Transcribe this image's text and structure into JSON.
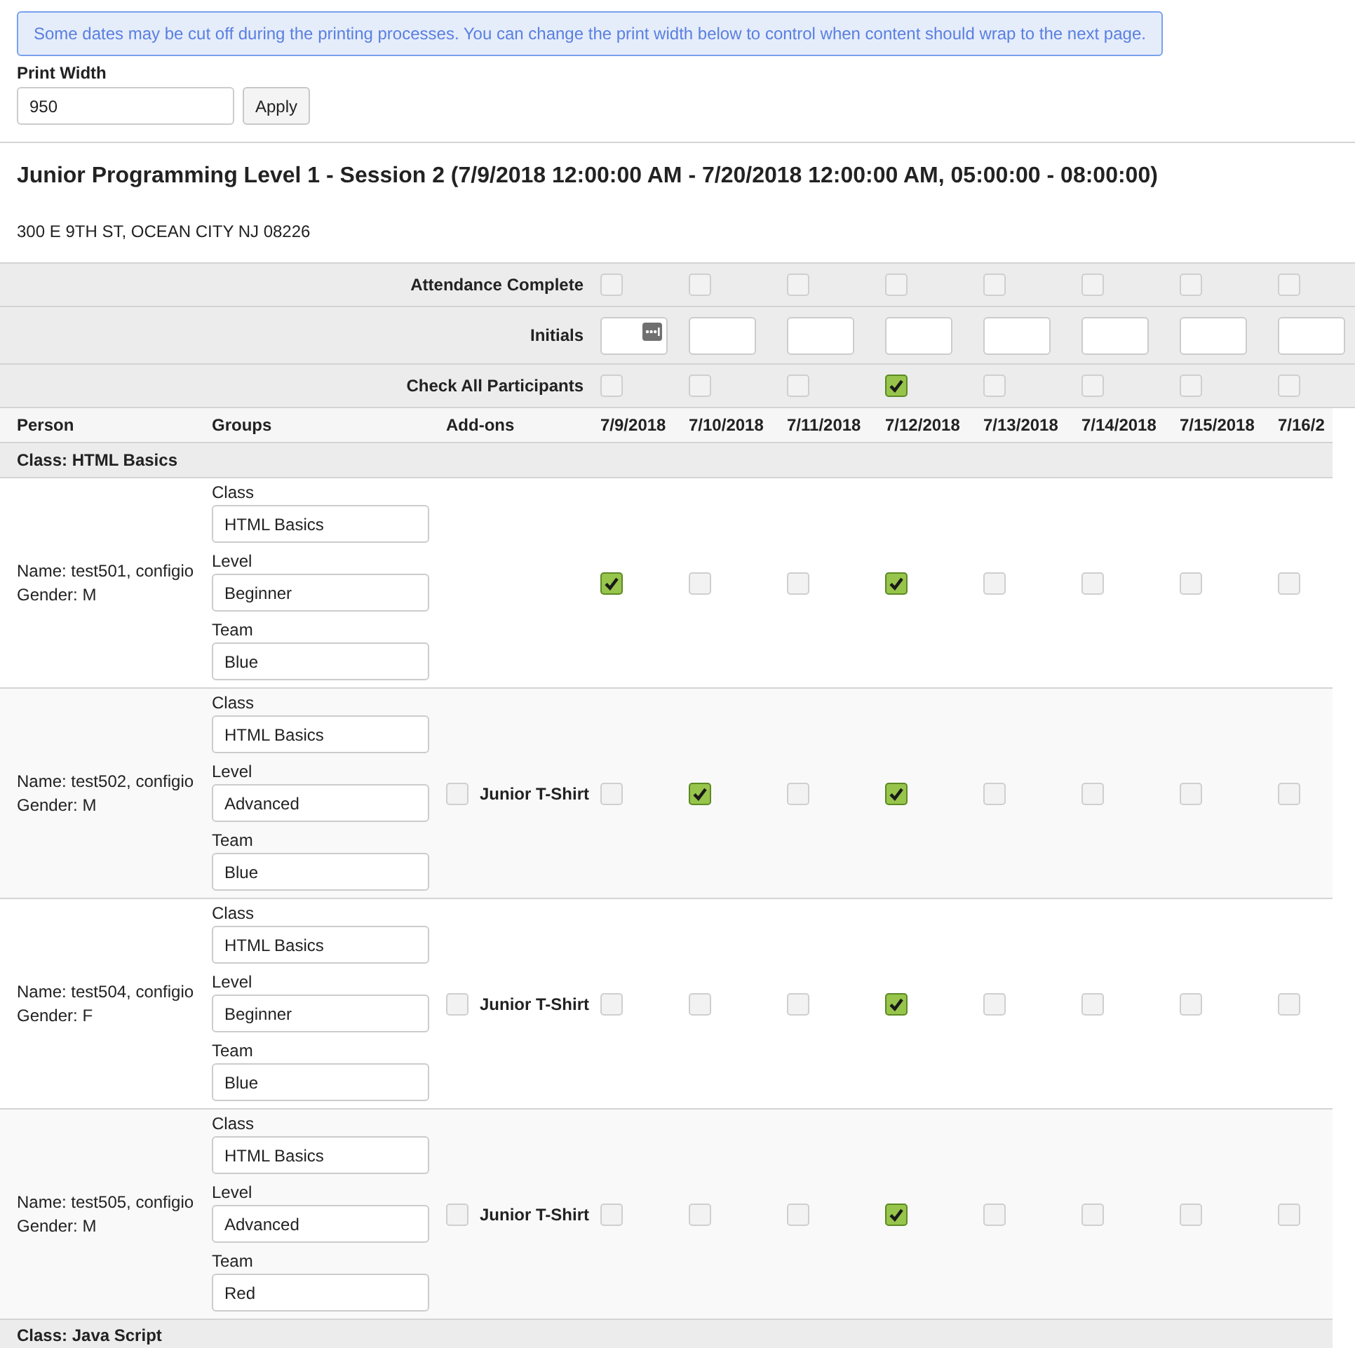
{
  "notice": "Some dates may be cut off during the printing processes. You can change the print width below to control when content should wrap to the next page.",
  "print_width": {
    "label": "Print Width",
    "value": "950",
    "button": "Apply"
  },
  "session": {
    "title": "Junior Programming Level 1 - Session 2 (7/9/2018 12:00:00 AM - 7/20/2018 12:00:00 AM, 05:00:00 - 08:00:00)",
    "address": "300 E 9TH ST, OCEAN CITY NJ 08226"
  },
  "row_labels": {
    "attendance_complete": "Attendance Complete",
    "initials": "Initials",
    "check_all": "Check All Participants"
  },
  "columns": [
    "Person",
    "Groups",
    "Add-ons"
  ],
  "dates": [
    {
      "label": "7/9/2018",
      "attendance_complete": false,
      "initials_icon": true,
      "check_all": false
    },
    {
      "label": "7/10/2018",
      "attendance_complete": false,
      "initials_icon": false,
      "check_all": false
    },
    {
      "label": "7/11/2018",
      "attendance_complete": false,
      "initials_icon": false,
      "check_all": false
    },
    {
      "label": "7/12/2018",
      "attendance_complete": false,
      "initials_icon": false,
      "check_all": true
    },
    {
      "label": "7/13/2018",
      "attendance_complete": false,
      "initials_icon": false,
      "check_all": false
    },
    {
      "label": "7/14/2018",
      "attendance_complete": false,
      "initials_icon": false,
      "check_all": false
    },
    {
      "label": "7/15/2018",
      "attendance_complete": false,
      "initials_icon": false,
      "check_all": false
    },
    {
      "label": "7/16/2",
      "attendance_complete": false,
      "initials_icon": false,
      "check_all": false
    }
  ],
  "classes": [
    {
      "name": "Class: HTML Basics",
      "participants": [
        {
          "name": "Name: test501, configio",
          "gender": "Gender: M",
          "groups": [
            {
              "label": "Class",
              "value": "HTML Basics"
            },
            {
              "label": "Level",
              "value": "Beginner"
            },
            {
              "label": "Team",
              "value": "Blue"
            }
          ],
          "attendance": [
            {
              "checked": true
            },
            {
              "checked": false
            },
            {
              "checked": false
            },
            {
              "checked": true
            },
            {
              "checked": false
            },
            {
              "checked": false
            },
            {
              "checked": false
            },
            {
              "checked": false
            }
          ]
        },
        {
          "name": "Name: test502, configio",
          "gender": "Gender: M",
          "groups": [
            {
              "label": "Class",
              "value": "HTML Basics"
            },
            {
              "label": "Level",
              "value": "Advanced"
            },
            {
              "label": "Team",
              "value": "Blue"
            }
          ],
          "addon": {
            "label": "Junior T-Shirt",
            "checked": false
          },
          "attendance": [
            {
              "checked": false
            },
            {
              "checked": true
            },
            {
              "checked": false
            },
            {
              "checked": true
            },
            {
              "checked": false
            },
            {
              "checked": false
            },
            {
              "checked": false
            },
            {
              "checked": false
            }
          ]
        },
        {
          "name": "Name: test504, configio",
          "gender": "Gender: F",
          "groups": [
            {
              "label": "Class",
              "value": "HTML Basics"
            },
            {
              "label": "Level",
              "value": "Beginner"
            },
            {
              "label": "Team",
              "value": "Blue"
            }
          ],
          "addon": {
            "label": "Junior T-Shirt",
            "checked": false
          },
          "attendance": [
            {
              "checked": false
            },
            {
              "checked": false
            },
            {
              "checked": false
            },
            {
              "checked": true
            },
            {
              "checked": false
            },
            {
              "checked": false
            },
            {
              "checked": false
            },
            {
              "checked": false
            }
          ]
        },
        {
          "name": "Name: test505, configio",
          "gender": "Gender: M",
          "groups": [
            {
              "label": "Class",
              "value": "HTML Basics"
            },
            {
              "label": "Level",
              "value": "Advanced"
            },
            {
              "label": "Team",
              "value": "Red"
            }
          ],
          "addon": {
            "label": "Junior T-Shirt",
            "checked": false
          },
          "attendance": [
            {
              "checked": false
            },
            {
              "checked": false
            },
            {
              "checked": false
            },
            {
              "checked": true
            },
            {
              "checked": false
            },
            {
              "checked": false
            },
            {
              "checked": false
            },
            {
              "checked": false
            }
          ]
        }
      ]
    },
    {
      "name": "Class: Java Script"
    }
  ]
}
